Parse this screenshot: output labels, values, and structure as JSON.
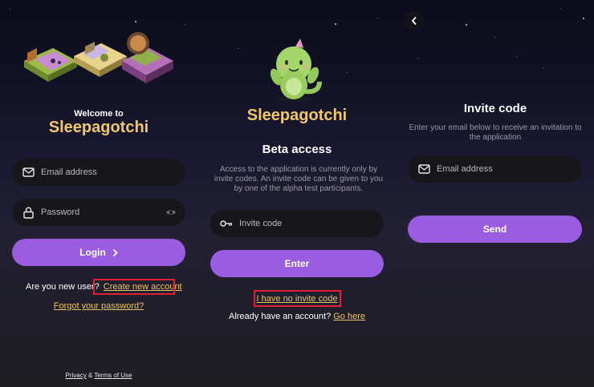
{
  "login": {
    "welcome": "Welcome to",
    "app_name": "Sleepagotchi",
    "email_placeholder": "Email address",
    "password_placeholder": "Password",
    "login_button": "Login",
    "new_user_text": "Are you new user?",
    "create_account_link": "Create new account",
    "forgot_password_link": "Forgot your password?",
    "privacy_link": "Privacy",
    "and_text": "&",
    "terms_link": "Terms of Use"
  },
  "beta": {
    "app_name": "Sleepagotchi",
    "title": "Beta access",
    "description": "Access to the application is currently only by invite codes. An invite code can be given to you by one of the alpha test participants.",
    "invite_placeholder": "Invite code",
    "enter_button": "Enter",
    "no_invite_link": "I have no invite code",
    "have_account_text": "Already have an account?",
    "go_here_link": "Go here"
  },
  "invite": {
    "title": "Invite code",
    "description": "Enter your email below to receive an invitation to the application",
    "email_placeholder": "Email address",
    "send_button": "Send"
  },
  "colors": {
    "accent": "#9a5ce0",
    "gold": "#f0c86a",
    "highlight": "#e0203a"
  },
  "icons": [
    "mail-icon",
    "lock-icon",
    "eye-icon",
    "chevron-right-icon",
    "key-icon",
    "back-arrow-icon"
  ]
}
